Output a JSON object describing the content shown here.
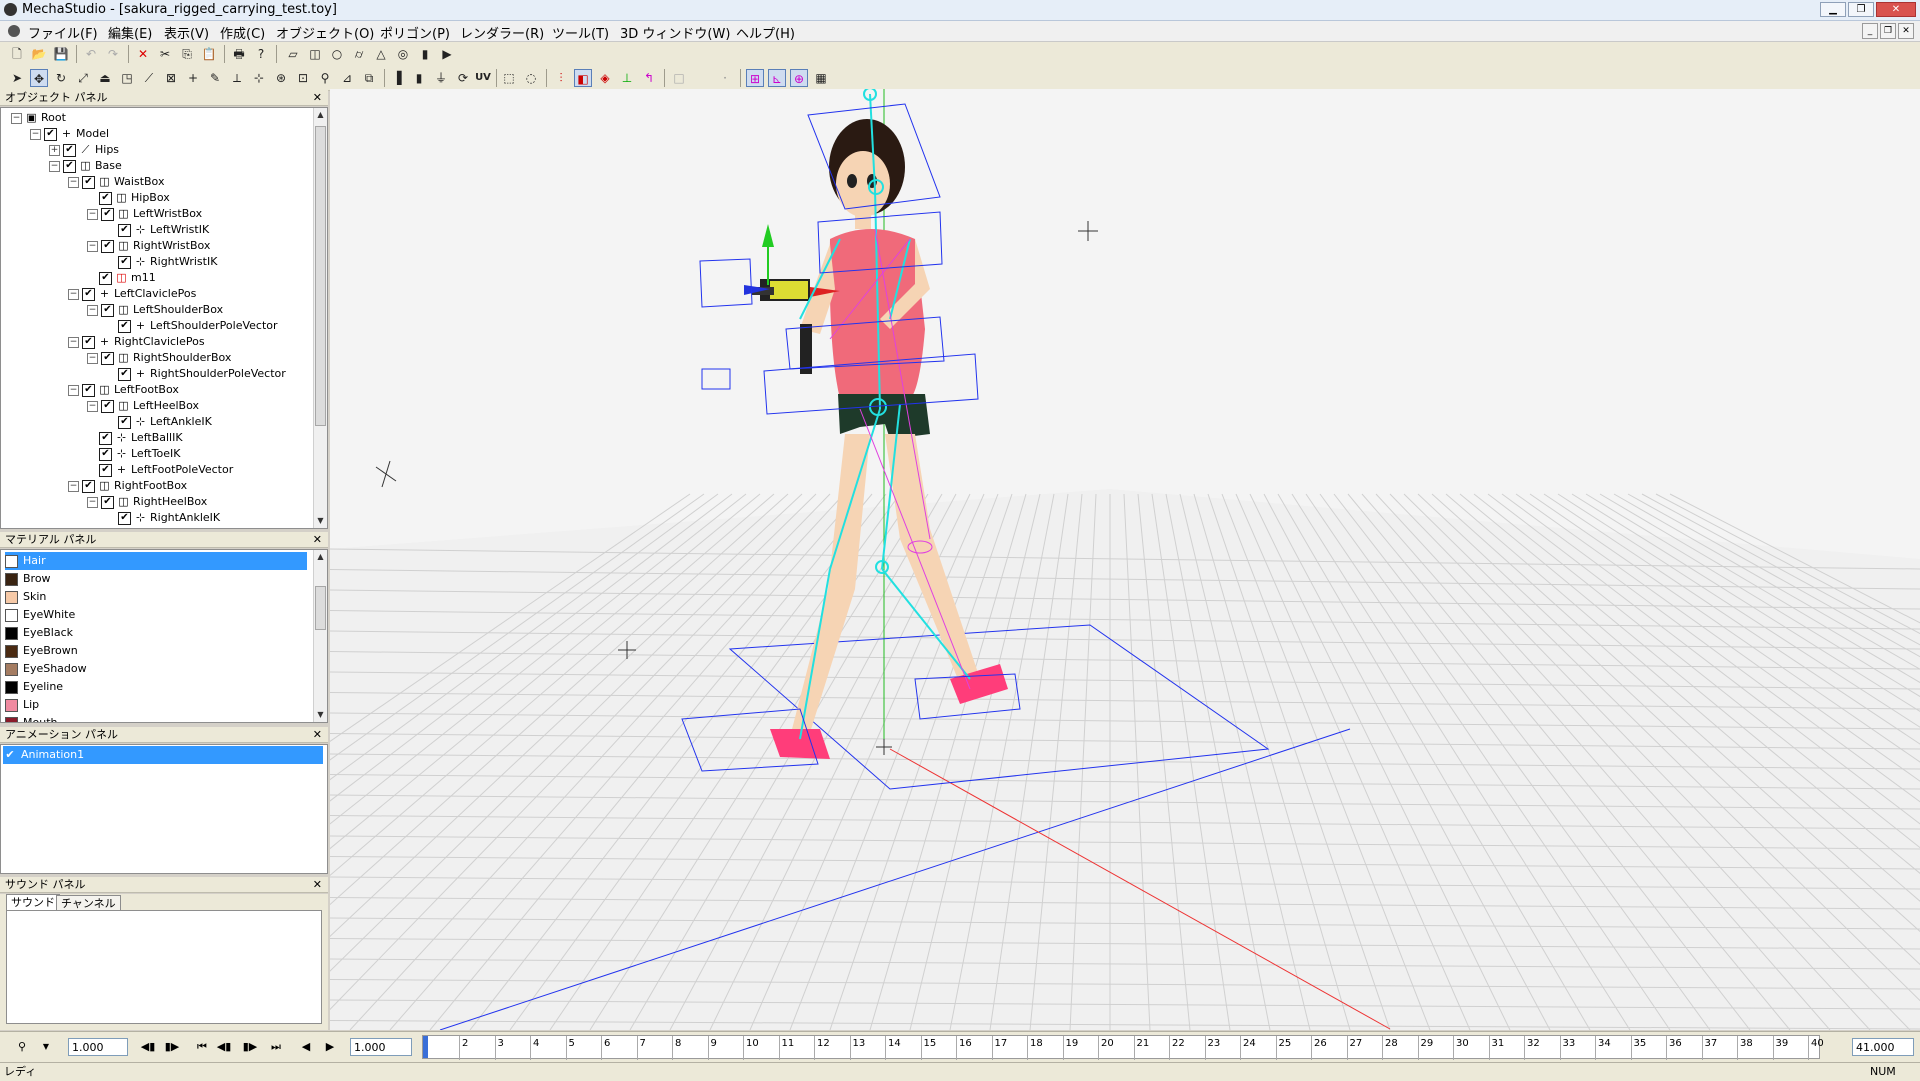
{
  "window": {
    "title": "MechaStudio - [sakura_rigged_carrying_test.toy]"
  },
  "menu": [
    "ファイル(F)",
    "編集(E)",
    "表示(V)",
    "作成(C)",
    "オブジェクト(O)",
    "ポリゴン(P)",
    "レンダラー(R)",
    "ツール(T)",
    "3D ウィンドウ(W)",
    "ヘルプ(H)"
  ],
  "toolbar": {
    "uv_label": "UV"
  },
  "object_panel": {
    "title": "オブジェクト パネル",
    "nodes": [
      {
        "label": "Root",
        "depth": 0,
        "exp": "-",
        "chk": false,
        "icon": "root"
      },
      {
        "label": "Model",
        "depth": 1,
        "exp": "-",
        "chk": true,
        "icon": "null"
      },
      {
        "label": "Hips",
        "depth": 2,
        "exp": "+",
        "chk": true,
        "icon": "bone"
      },
      {
        "label": "Base",
        "depth": 2,
        "exp": "-",
        "chk": true,
        "icon": "box"
      },
      {
        "label": "WaistBox",
        "depth": 3,
        "exp": "-",
        "chk": true,
        "icon": "box"
      },
      {
        "label": "HipBox",
        "depth": 4,
        "exp": "",
        "chk": true,
        "icon": "box"
      },
      {
        "label": "LeftWristBox",
        "depth": 4,
        "exp": "-",
        "chk": true,
        "icon": "box"
      },
      {
        "label": "LeftWristIK",
        "depth": 5,
        "exp": "",
        "chk": true,
        "icon": "ik"
      },
      {
        "label": "RightWristBox",
        "depth": 4,
        "exp": "-",
        "chk": true,
        "icon": "box"
      },
      {
        "label": "RightWristIK",
        "depth": 5,
        "exp": "",
        "chk": true,
        "icon": "ik"
      },
      {
        "label": "m11",
        "depth": 4,
        "exp": "",
        "chk": true,
        "icon": "mesh"
      },
      {
        "label": "LeftClaviclePos",
        "depth": 3,
        "exp": "-",
        "chk": true,
        "icon": "null"
      },
      {
        "label": "LeftShoulderBox",
        "depth": 4,
        "exp": "-",
        "chk": true,
        "icon": "box"
      },
      {
        "label": "LeftShoulderPoleVector",
        "depth": 5,
        "exp": "",
        "chk": true,
        "icon": "null"
      },
      {
        "label": "RightClaviclePos",
        "depth": 3,
        "exp": "-",
        "chk": true,
        "icon": "null"
      },
      {
        "label": "RightShoulderBox",
        "depth": 4,
        "exp": "-",
        "chk": true,
        "icon": "box"
      },
      {
        "label": "RightShoulderPoleVector",
        "depth": 5,
        "exp": "",
        "chk": true,
        "icon": "null"
      },
      {
        "label": "LeftFootBox",
        "depth": 3,
        "exp": "-",
        "chk": true,
        "icon": "box"
      },
      {
        "label": "LeftHeelBox",
        "depth": 4,
        "exp": "-",
        "chk": true,
        "icon": "box"
      },
      {
        "label": "LeftAnkleIK",
        "depth": 5,
        "exp": "",
        "chk": true,
        "icon": "ik"
      },
      {
        "label": "LeftBallIK",
        "depth": 4,
        "exp": "",
        "chk": true,
        "icon": "ik"
      },
      {
        "label": "LeftToeIK",
        "depth": 4,
        "exp": "",
        "chk": true,
        "icon": "ik"
      },
      {
        "label": "LeftFootPoleVector",
        "depth": 4,
        "exp": "",
        "chk": true,
        "icon": "null"
      },
      {
        "label": "RightFootBox",
        "depth": 3,
        "exp": "-",
        "chk": true,
        "icon": "box"
      },
      {
        "label": "RightHeelBox",
        "depth": 4,
        "exp": "-",
        "chk": true,
        "icon": "box"
      },
      {
        "label": "RightAnkleIK",
        "depth": 5,
        "exp": "",
        "chk": true,
        "icon": "ik"
      }
    ]
  },
  "material_panel": {
    "title": "マテリアル パネル",
    "items": [
      {
        "label": "Hair",
        "color": "#ffffff",
        "selected": true
      },
      {
        "label": "Brow",
        "color": "#3a2412"
      },
      {
        "label": "Skin",
        "color": "#f6c9a7"
      },
      {
        "label": "EyeWhite",
        "color": "#ffffff"
      },
      {
        "label": "EyeBlack",
        "color": "#000000"
      },
      {
        "label": "EyeBrown",
        "color": "#4a2a12"
      },
      {
        "label": "EyeShadow",
        "color": "#a47c62"
      },
      {
        "label": "Eyeline",
        "color": "#000000"
      },
      {
        "label": "Lip",
        "color": "#f08aa0"
      },
      {
        "label": "Mouth",
        "color": "#8a1a2a"
      }
    ]
  },
  "animation_panel": {
    "title": "アニメーション パネル",
    "items": [
      {
        "label": "Animation1",
        "checked": true
      }
    ]
  },
  "sound_panel": {
    "title": "サウンド パネル",
    "tabs": [
      "サウンド",
      "チャンネル"
    ]
  },
  "timeline": {
    "speed": "1.000",
    "current_frame": "1.000",
    "end_value": "41.000",
    "frames": [
      "2",
      "3",
      "4",
      "5",
      "6",
      "7",
      "8",
      "9",
      "10",
      "11",
      "12",
      "13",
      "14",
      "15",
      "16",
      "17",
      "18",
      "19",
      "20",
      "21",
      "22",
      "23",
      "24",
      "25",
      "26",
      "27",
      "28",
      "29",
      "30",
      "31",
      "32",
      "33",
      "34",
      "35",
      "36",
      "37",
      "38",
      "39",
      "40"
    ]
  },
  "status": {
    "left": "レディ",
    "right": "NUM"
  }
}
